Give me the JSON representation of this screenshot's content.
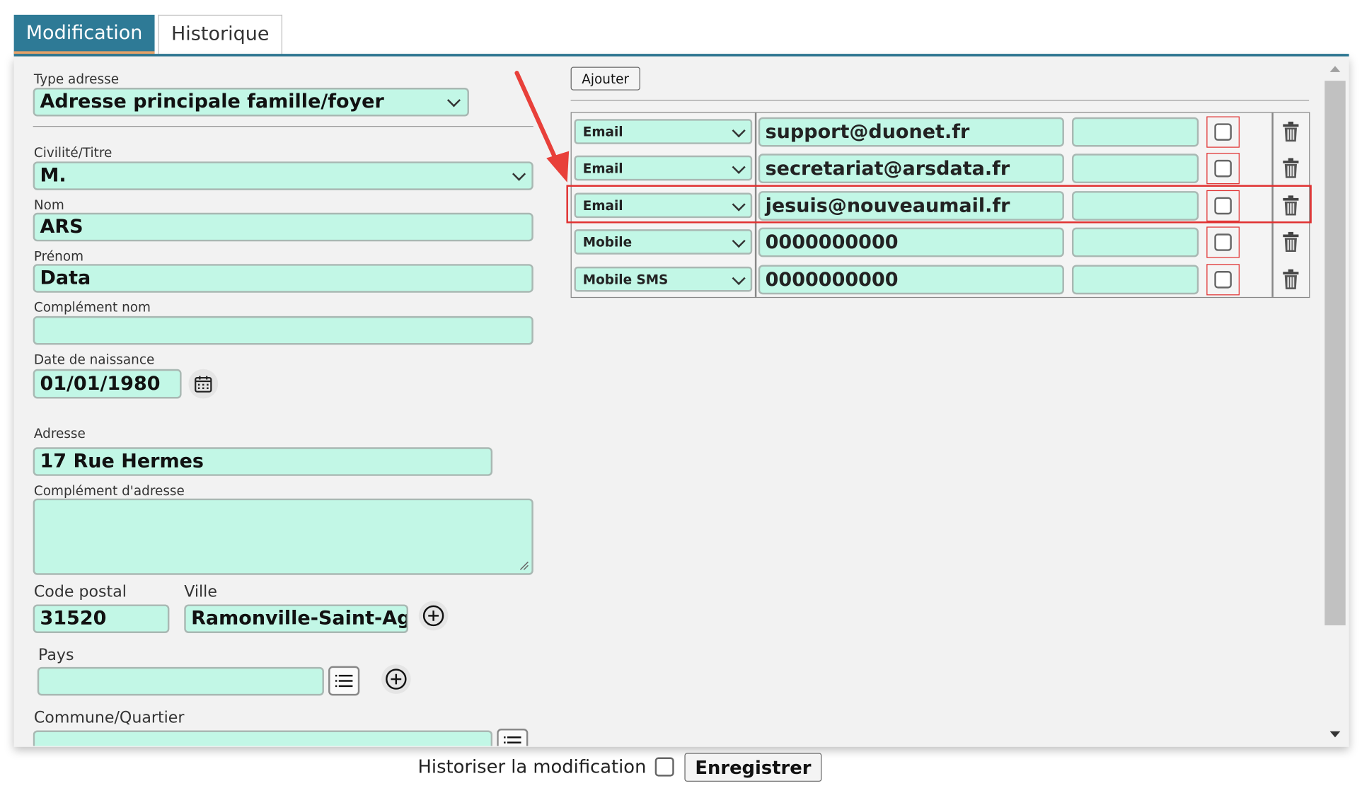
{
  "tabs": [
    {
      "label": "Modification",
      "active": true
    },
    {
      "label": "Historique",
      "active": false
    }
  ],
  "form": {
    "type_adresse": {
      "label": "Type adresse",
      "value": "Adresse principale famille/foyer"
    },
    "civilite": {
      "label": "Civilité/Titre",
      "value": "M."
    },
    "nom": {
      "label": "Nom",
      "value": "ARS"
    },
    "prenom": {
      "label": "Prénom",
      "value": "Data"
    },
    "complement_nom": {
      "label": "Complément nom",
      "value": ""
    },
    "date_naissance": {
      "label": "Date de naissance",
      "value": "01/01/1980"
    },
    "adresse": {
      "label": "Adresse",
      "value": "17 Rue Hermes"
    },
    "complement_adresse": {
      "label": "Complément d'adresse",
      "value": ""
    },
    "code_postal": {
      "label": "Code postal",
      "value": "31520"
    },
    "ville": {
      "label": "Ville",
      "value": "Ramonville-Saint-Ag"
    },
    "pays": {
      "label": "Pays",
      "value": ""
    },
    "commune": {
      "label": "Commune/Quartier",
      "value": ""
    }
  },
  "contacts": {
    "add_label": "Ajouter",
    "rows": [
      {
        "type": "Email",
        "value": "support@duonet.fr",
        "extra": "",
        "checked": false
      },
      {
        "type": "Email",
        "value": "secretariat@arsdata.fr",
        "extra": "",
        "checked": false
      },
      {
        "type": "Email",
        "value": "jesuis@nouveaumail.fr",
        "extra": "",
        "checked": false,
        "highlighted": true
      },
      {
        "type": "Mobile",
        "value": "0000000000",
        "extra": "",
        "checked": false
      },
      {
        "type": "Mobile SMS",
        "value": "0000000000",
        "extra": "",
        "checked": false
      }
    ]
  },
  "footer": {
    "historiser_label": "Historiser la modification",
    "historiser_checked": false,
    "save_label": "Enregistrer"
  },
  "colors": {
    "accent": "#2e7a96",
    "field_bg": "#c2f7e6",
    "highlight": "#e03030",
    "tab_underline": "#e8a46a"
  },
  "icons": [
    "calendar-icon",
    "plus-circle-icon",
    "list-icon",
    "trash-icon",
    "chevron-down-icon",
    "annotation-arrow",
    "scroll-up-icon",
    "scroll-down-icon"
  ]
}
